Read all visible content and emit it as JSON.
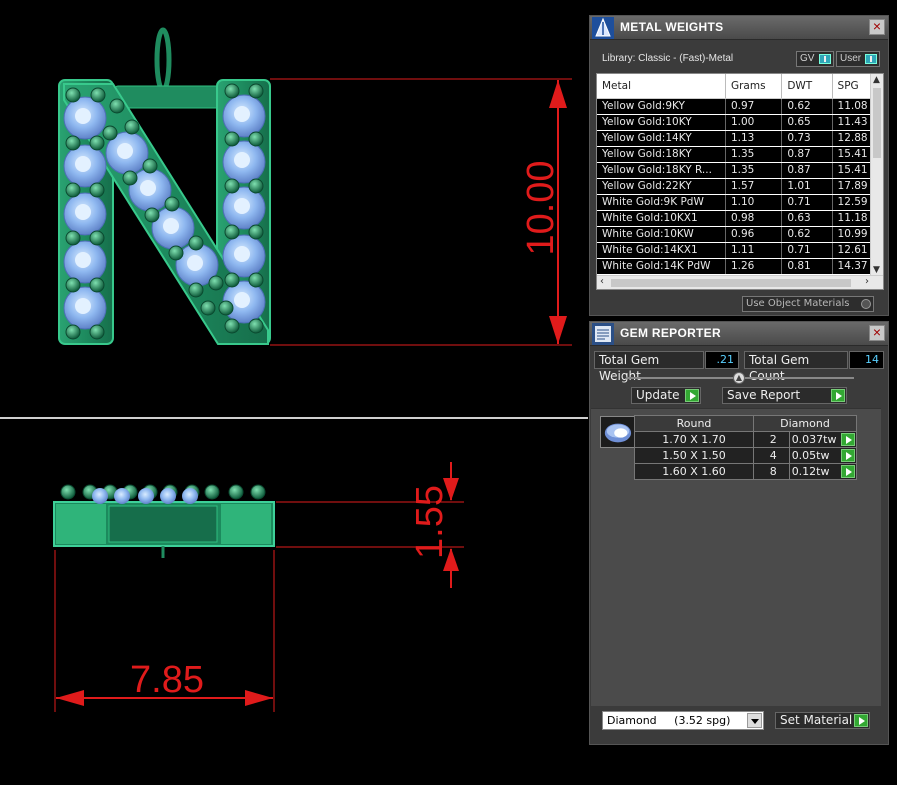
{
  "viewport": {
    "dim_height_top": "10.00",
    "dim_height_side": "1.55",
    "dim_width": "7.85",
    "accent_red": "#e01b1b",
    "model_green": "#1f8c5f"
  },
  "metal_weights": {
    "title": "METAL WEIGHTS",
    "library": "Library: Classic - (Fast)-Metal",
    "gv_label": "GV",
    "user_label": "User",
    "columns": [
      "Metal",
      "Grams",
      "DWT",
      "SPG"
    ],
    "rows": [
      [
        "Yellow Gold:9KY",
        "0.97",
        "0.62",
        "11.08"
      ],
      [
        "Yellow Gold:10KY",
        "1.00",
        "0.65",
        "11.43"
      ],
      [
        "Yellow Gold:14KY",
        "1.13",
        "0.73",
        "12.88"
      ],
      [
        "Yellow Gold:18KY",
        "1.35",
        "0.87",
        "15.41"
      ],
      [
        "Yellow Gold:18KY R...",
        "1.35",
        "0.87",
        "15.41"
      ],
      [
        "Yellow Gold:22KY",
        "1.57",
        "1.01",
        "17.89"
      ],
      [
        "White Gold:9K PdW",
        "1.10",
        "0.71",
        "12.59"
      ],
      [
        "White Gold:10KX1",
        "0.98",
        "0.63",
        "11.18"
      ],
      [
        "White Gold:10KW",
        "0.96",
        "0.62",
        "10.99"
      ],
      [
        "White Gold:14KX1",
        "1.11",
        "0.71",
        "12.61"
      ],
      [
        "White Gold:14K PdW",
        "1.26",
        "0.81",
        "14.37"
      ]
    ],
    "use_object_materials": "Use Object Materials"
  },
  "gem_reporter": {
    "title": "GEM REPORTER",
    "total_weight_label": "Total Gem Weight",
    "total_weight_value": ".21",
    "total_count_label": "Total Gem Count",
    "total_count_value": "14",
    "update_label": "Update",
    "save_report_label": "Save Report",
    "table_headers": [
      "Round",
      "Diamond"
    ],
    "rows": [
      [
        "1.70 X 1.70",
        "2",
        "0.037tw"
      ],
      [
        "1.50 X 1.50",
        "4",
        "0.05tw"
      ],
      [
        "1.60 X 1.60",
        "8",
        "0.12tw"
      ]
    ],
    "material_select": "Diamond     (3.52 spg)",
    "set_material_label": "Set Material"
  }
}
